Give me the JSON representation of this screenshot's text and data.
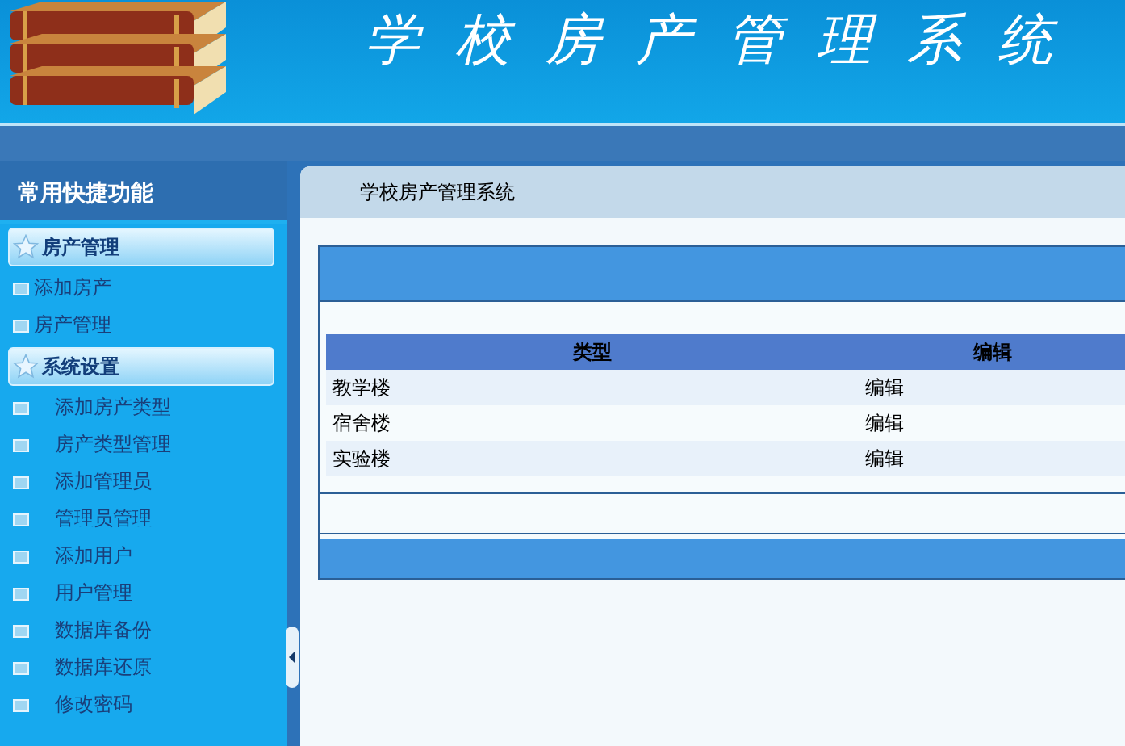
{
  "header": {
    "title": "学校房产管理系统"
  },
  "sidebar": {
    "title": "常用快捷功能",
    "groups": [
      {
        "label": "房产管理",
        "items": [
          "添加房产",
          "房产管理"
        ]
      },
      {
        "label": "系统设置",
        "items": [
          "添加房产类型",
          "房产类型管理",
          "添加管理员",
          "管理员管理",
          "添加用户",
          "用户管理",
          "数据库备份",
          "数据库还原",
          "修改密码"
        ]
      }
    ]
  },
  "breadcrumb": "学校房产管理系统",
  "table": {
    "columns": [
      "类型",
      "编辑"
    ],
    "rows": [
      {
        "type": "教学楼",
        "action": "编辑"
      },
      {
        "type": "宿舍楼",
        "action": "编辑"
      },
      {
        "type": "实验楼",
        "action": "编辑"
      }
    ]
  }
}
